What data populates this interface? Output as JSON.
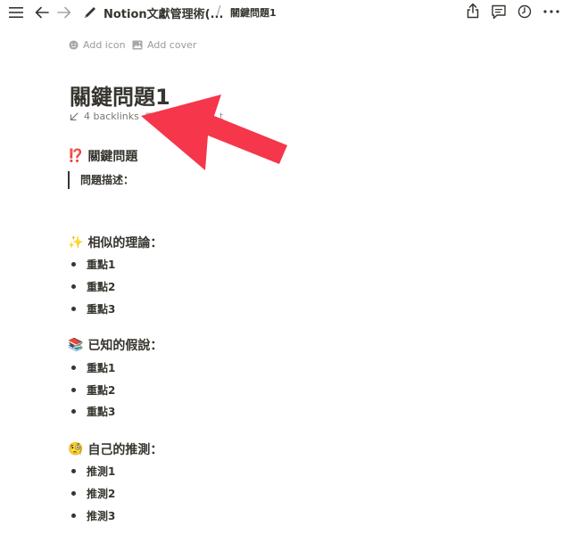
{
  "topbar": {
    "breadcrumb_parent": "Notion文獻管理術(...",
    "separator": "/",
    "breadcrumb_current": "關鍵問題1",
    "icons": [
      "menu-icon",
      "back-arrow-icon",
      "forward-arrow-icon",
      "pen-icon",
      "share-icon",
      "comment-icon",
      "clock-icon",
      "more-icon"
    ]
  },
  "page_meta": {
    "add_icon": "Add icon",
    "add_cover": "Add cover"
  },
  "page": {
    "title": "關鍵問題1",
    "backlinks": "4 backlinks",
    "comment_partial": "t"
  },
  "sections": {
    "problem": {
      "emoji": "⁉️",
      "heading": "關鍵問題",
      "quote": "問題描述："
    },
    "theory": {
      "emoji": "✨",
      "heading": "相似的理論：",
      "items": [
        "重點1",
        "重點2",
        "重點3"
      ]
    },
    "hypothesis": {
      "emoji": "📚",
      "heading": "已知的假說：",
      "items": [
        "重點1",
        "重點2",
        "重點3"
      ]
    },
    "guess": {
      "emoji": "🧐",
      "heading": "自己的推測：",
      "items": [
        "推測1",
        "推測2",
        "推測3"
      ]
    }
  },
  "annotation": {
    "arrow_color": "#f5364b"
  }
}
